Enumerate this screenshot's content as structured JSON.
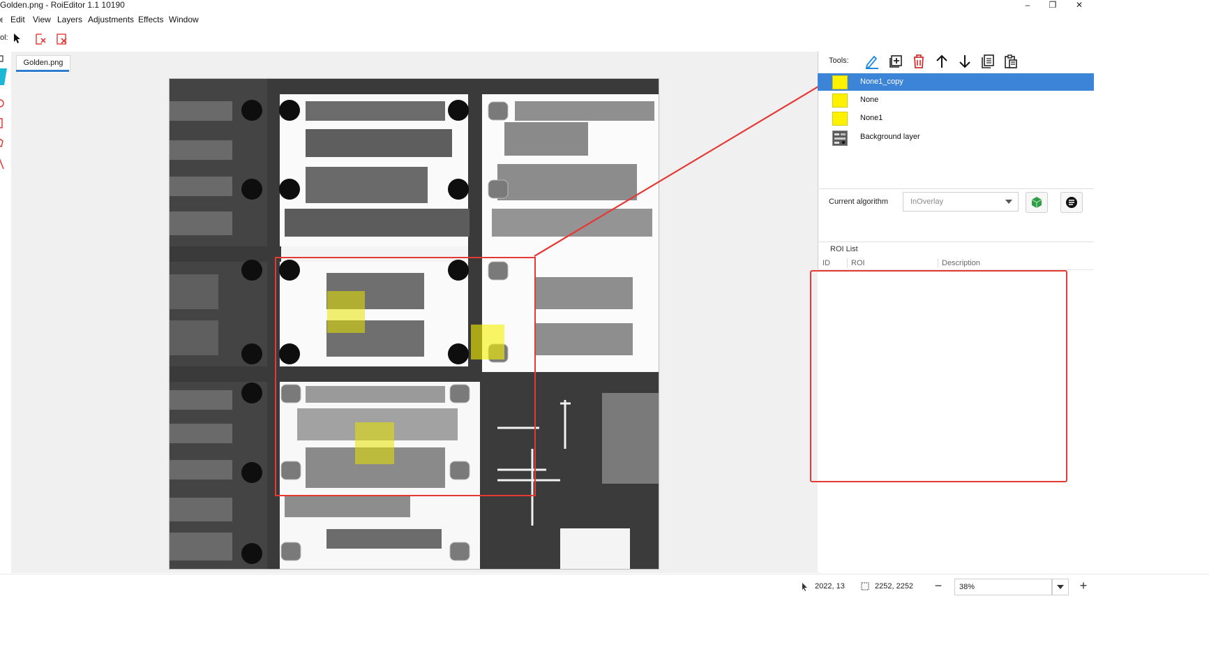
{
  "window": {
    "title": "Golden.png - RoiEditor 1.1 10190",
    "minimize_glyph": "–",
    "restore_glyph": "❐",
    "close_glyph": "✕"
  },
  "menu": [
    "Edit",
    "View",
    "Layers",
    "Adjustments",
    "Effects",
    "Window"
  ],
  "toolbar": {
    "tool_label": "ol:"
  },
  "document_tab": {
    "label": "Golden.png"
  },
  "right_panel": {
    "tools_label": "Tools:",
    "tool_icons": [
      "pencil-icon",
      "add-layer-icon",
      "delete-icon",
      "arrow-up-icon",
      "arrow-down-icon",
      "copy-icon",
      "paste-icon"
    ],
    "layers": [
      {
        "label": "None1_copy",
        "selected": true,
        "swatch": "#fff200"
      },
      {
        "label": "None",
        "selected": false,
        "swatch": "#fff200"
      },
      {
        "label": "None1",
        "selected": false,
        "swatch": "#fff200"
      },
      {
        "label": "Background layer",
        "selected": false,
        "swatch": "thumbnail"
      }
    ],
    "algorithm_label": "Current algorithm",
    "algorithm_value": "InOverlay",
    "roi_list_title": "ROI List",
    "roi_columns": [
      "ID",
      "ROI",
      "Description"
    ],
    "roi_rows": []
  },
  "status": {
    "cursor_pos": "2022, 13",
    "image_size": "2252, 2252",
    "zoom": "38%"
  },
  "colors": {
    "accent": "#3c84d8",
    "annotation": "#e53935",
    "roi_fill": "#fff200"
  }
}
